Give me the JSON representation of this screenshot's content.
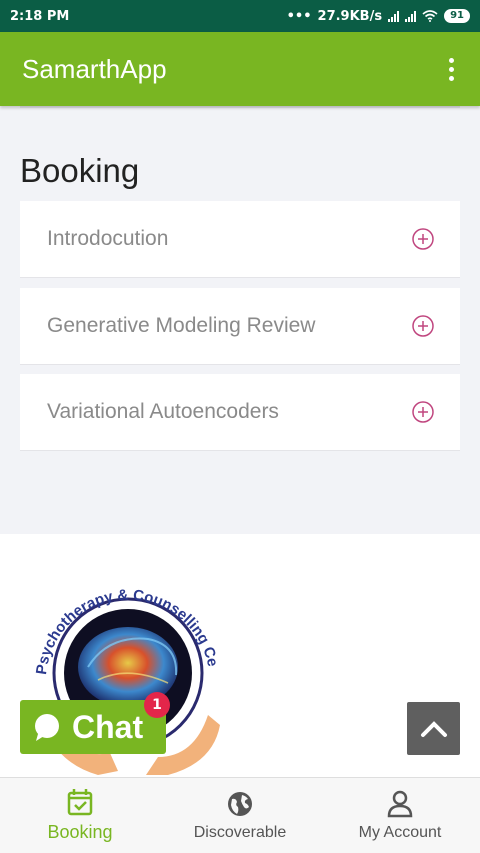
{
  "status_bar": {
    "time": "2:18 PM",
    "network_speed": "27.9KB/s",
    "battery": "91"
  },
  "app_bar": {
    "title": "SamarthApp",
    "menu_icon": "kebab-menu-icon"
  },
  "booking": {
    "title": "Booking",
    "items": [
      {
        "label": "Introdocution",
        "icon": "plus-circle-icon"
      },
      {
        "label": "Generative Modeling Review",
        "icon": "plus-circle-icon"
      },
      {
        "label": "Variational Autoencoders",
        "icon": "plus-circle-icon"
      }
    ]
  },
  "logo": {
    "text": "Psychotherapy & Counselling Centre"
  },
  "chat": {
    "label": "Chat",
    "badge": "1"
  },
  "bottom_nav": {
    "items": [
      {
        "label": "Booking",
        "icon": "calendar-check-icon",
        "active": true
      },
      {
        "label": "Discoverable",
        "icon": "globe-icon",
        "active": false
      },
      {
        "label": "My Account",
        "icon": "person-icon",
        "active": false
      }
    ]
  },
  "colors": {
    "accent": "#79b622",
    "status_bar": "#0b5d45",
    "plus_icon": "#c0467f",
    "badge": "#e3264a"
  }
}
